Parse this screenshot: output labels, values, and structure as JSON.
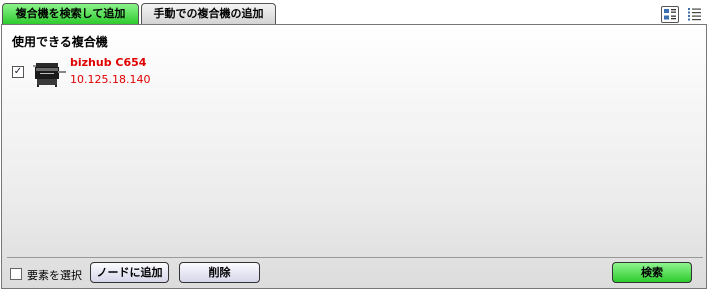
{
  "tabs": [
    {
      "label": "複合機を検索して追加",
      "active": true
    },
    {
      "label": "手動での複合機の追加",
      "active": false
    }
  ],
  "view_icons": [
    "details-view-icon",
    "list-view-icon"
  ],
  "section_title": "使用できる複合機",
  "devices": [
    {
      "name": "bizhub C654",
      "ip": "10.125.18.140",
      "checked": true,
      "icon": "printer-icon"
    }
  ],
  "footer": {
    "select_all_label": "要素を選択",
    "add_node_label": "ノードに追加",
    "delete_label": "削除",
    "search_label": "検索"
  },
  "colors": {
    "active_tab": "#2ecb2e",
    "device_text": "#e00000",
    "search_button": "#2ecb2e"
  }
}
